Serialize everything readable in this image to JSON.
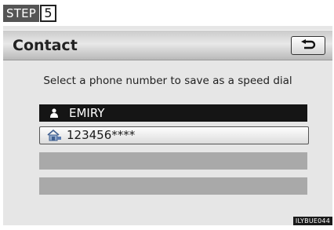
{
  "step": {
    "label": "STEP",
    "number": "5"
  },
  "header": {
    "title": "Contact"
  },
  "instruction": "Select a phone number to save as a speed dial",
  "contact": {
    "name": "EMIRY"
  },
  "phone_numbers": [
    {
      "number": "123456****",
      "icon": "home-phone-icon"
    }
  ],
  "illustration_code": "ILYBUE044",
  "icons": {
    "back": "return-arrow-icon",
    "person": "person-icon"
  }
}
